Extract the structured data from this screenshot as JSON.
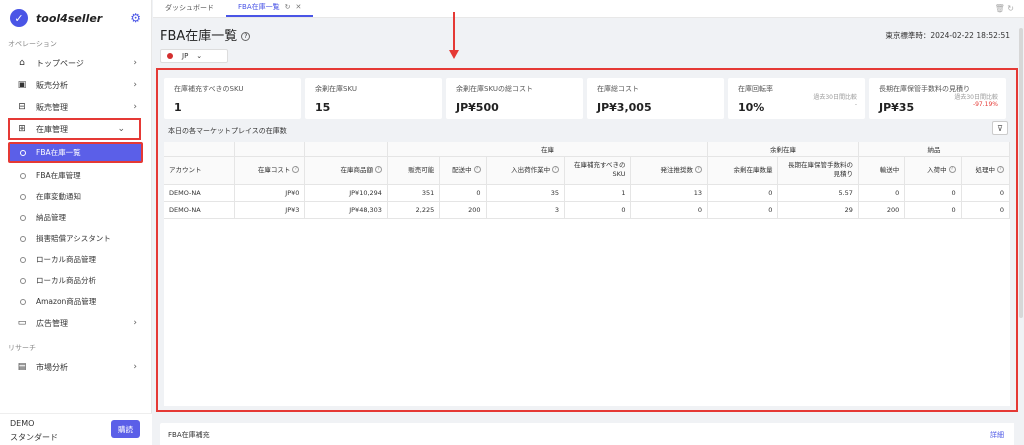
{
  "app": {
    "name": "tool4seller"
  },
  "sidebar": {
    "section_operation": "オペレーション",
    "section_research": "リサーチ",
    "items": [
      {
        "label": "トップページ",
        "icon": "home-icon"
      },
      {
        "label": "販売分析",
        "icon": "chart-icon"
      },
      {
        "label": "販売管理",
        "icon": "sales-icon"
      },
      {
        "label": "在庫管理",
        "icon": "box-icon"
      }
    ],
    "inventory_sub": [
      {
        "label": "FBA在庫一覧"
      },
      {
        "label": "FBA在庫管理"
      },
      {
        "label": "在庫変動通知"
      },
      {
        "label": "納品管理"
      },
      {
        "label": "損害賠償アシスタント"
      },
      {
        "label": "ローカル商品管理"
      },
      {
        "label": "ローカル商品分析"
      },
      {
        "label": "Amazon商品管理"
      }
    ],
    "ads_label": "広告管理",
    "market_label": "市場分析",
    "user": {
      "name": "DEMO",
      "plan": "スタンダード",
      "buy_label": "購読"
    }
  },
  "tabs": [
    {
      "label": "ダッシュボード"
    },
    {
      "label": "FBA在庫一覧"
    }
  ],
  "page": {
    "title": "FBA在庫一覧",
    "time_label": "東京標準時：2024-02-22 18:52:51",
    "marketplace": "JP"
  },
  "stats": [
    {
      "label": "在庫補充すべきのSKU",
      "value": "1"
    },
    {
      "label": "余剰在庫SKU",
      "value": "15"
    },
    {
      "label": "余剰在庫SKUの総コスト",
      "value": "JP¥500"
    },
    {
      "label": "在庫総コスト",
      "value": "JP¥3,005"
    },
    {
      "label": "在庫回転率",
      "value": "10%",
      "compare_label": "過去30日間比較",
      "compare_value": "-"
    },
    {
      "label": "長期在庫保管手数料の見積り",
      "value": "JP¥35",
      "compare_label": "過去30日間比較",
      "compare_value": "-97.19%"
    }
  ],
  "inventory_label": "本日の各マーケットプレイスの在庫数",
  "table": {
    "groups": {
      "stock": "在庫",
      "surplus": "余剰在庫",
      "delivery": "納品"
    },
    "columns": {
      "account": "アカウント",
      "stock_cost": "在庫コスト",
      "stock_amount": "在庫商品額",
      "sellable": "販売可能",
      "shipping": "配送中",
      "processing": "入出荷作業中",
      "restock_sku": "在庫補充すべきのSKU",
      "order_qty": "発注推奨数",
      "surplus_qty": "余剰在庫数量",
      "long_term_fee": "長期在庫保管手数料の見積り",
      "outbound": "輸送中",
      "inbound": "入荷中",
      "receiving": "処理中"
    },
    "rows": [
      {
        "account": "DEMO-NA",
        "stock_cost": "JP¥0",
        "stock_amount": "JP¥10,294",
        "sellable": "351",
        "shipping": "0",
        "processing": "35",
        "restock_sku": "1",
        "order_qty": "13",
        "surplus_qty": "0",
        "long_term_fee": "5.57",
        "outbound": "0",
        "inbound": "0",
        "receiving": "0"
      },
      {
        "account": "DEMO-NA",
        "stock_cost": "JP¥3",
        "stock_amount": "JP¥48,303",
        "sellable": "2,225",
        "shipping": "200",
        "processing": "3",
        "restock_sku": "0",
        "order_qty": "0",
        "surplus_qty": "0",
        "long_term_fee": "29",
        "outbound": "200",
        "inbound": "0",
        "receiving": "0"
      }
    ]
  },
  "bottom": {
    "title": "FBA在庫補充",
    "link": "詳細"
  },
  "colors": {
    "accent": "#5b5fe8",
    "highlight": "#e53935"
  }
}
